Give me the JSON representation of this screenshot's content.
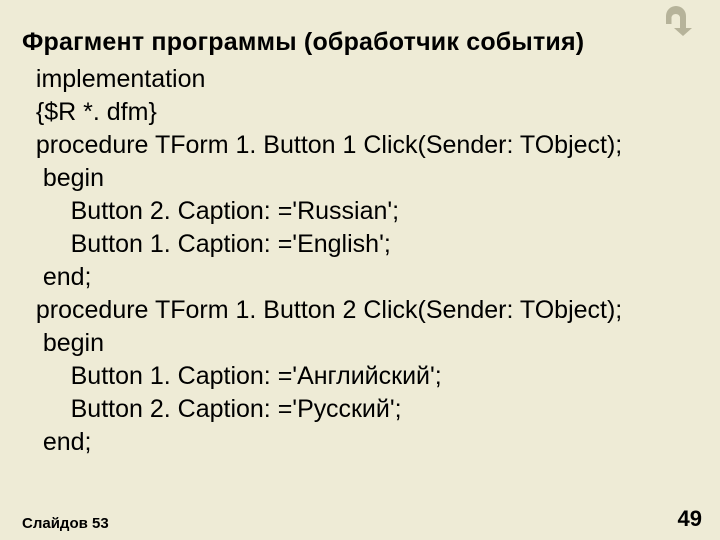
{
  "title": "Фрагмент программы (обработчик события)",
  "code": "  implementation\n  {$R *. dfm}\n  procedure TForm 1. Button 1 Click(Sender: TObject);\n   begin\n       Button 2. Caption: ='Russian';\n       Button 1. Caption: ='English';\n   end;\n  procedure TForm 1. Button 2 Click(Sender: TObject);\n   begin\n       Button 1. Caption: ='Английский';\n       Button 2. Caption: ='Русский';\n   end;",
  "footer": {
    "slidecount": "Слайдов 53",
    "pagenum": "49"
  },
  "icons": {
    "return": "return-icon"
  }
}
